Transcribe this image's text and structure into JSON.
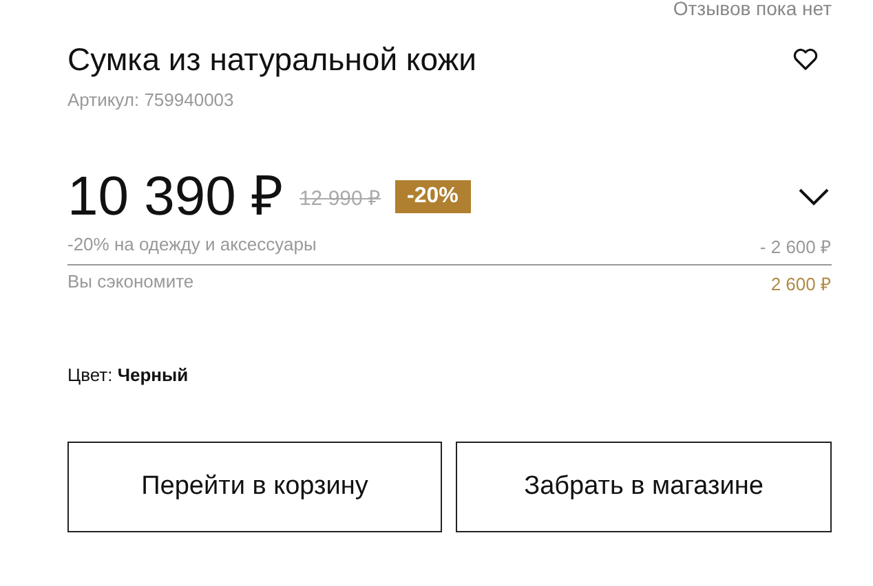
{
  "reviews": "Отзывов пока нет",
  "title": "Сумка из натуральной кожи",
  "article": "Артикул: 759940003",
  "price": "10 390 ₽",
  "old_price": "12 990 ₽",
  "discount_badge": "-20%",
  "discounts": [
    {
      "label": "-20% на одежду и аксессуары",
      "amount": "- 2 600 ₽"
    }
  ],
  "savings": {
    "label": "Вы сэкономите",
    "amount": "2 600 ₽"
  },
  "color_option": {
    "label": "Цвет:",
    "value": "Черный"
  },
  "buttons": [
    "Перейти в корзину",
    "Забрать в магазине"
  ]
}
